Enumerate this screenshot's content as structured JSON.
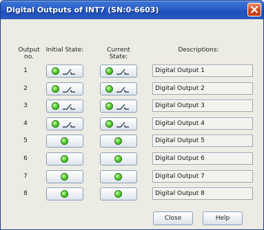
{
  "window": {
    "title": "Digital Outputs of INT7 (SN:0-6603)"
  },
  "headers": {
    "output_no": [
      "Output",
      "no."
    ],
    "initial_state": "Initial State:",
    "current_state": [
      "Current",
      "State:"
    ],
    "descriptions": "Descriptions:"
  },
  "rows": [
    {
      "no": "1",
      "relay": true,
      "description": "Digital Output 1"
    },
    {
      "no": "2",
      "relay": true,
      "description": "Digital Output 2"
    },
    {
      "no": "3",
      "relay": true,
      "description": "Digital Output 3"
    },
    {
      "no": "4",
      "relay": true,
      "description": "Digital Output 4"
    },
    {
      "no": "5",
      "relay": false,
      "description": "Digital Output 5"
    },
    {
      "no": "6",
      "relay": false,
      "description": "Digital Output 6"
    },
    {
      "no": "7",
      "relay": false,
      "description": "Digital Output 7"
    },
    {
      "no": "8",
      "relay": false,
      "description": "Digital Output 8"
    }
  ],
  "buttons": {
    "close": "Close",
    "help": "Help"
  },
  "colors": {
    "title_bar": "#2a5ec8",
    "led_on": "#5bd132",
    "panel": "#ecebe4"
  },
  "icons": {
    "close": "close-x-icon",
    "led": "green-led-icon",
    "relay": "relay-switch-icon"
  }
}
